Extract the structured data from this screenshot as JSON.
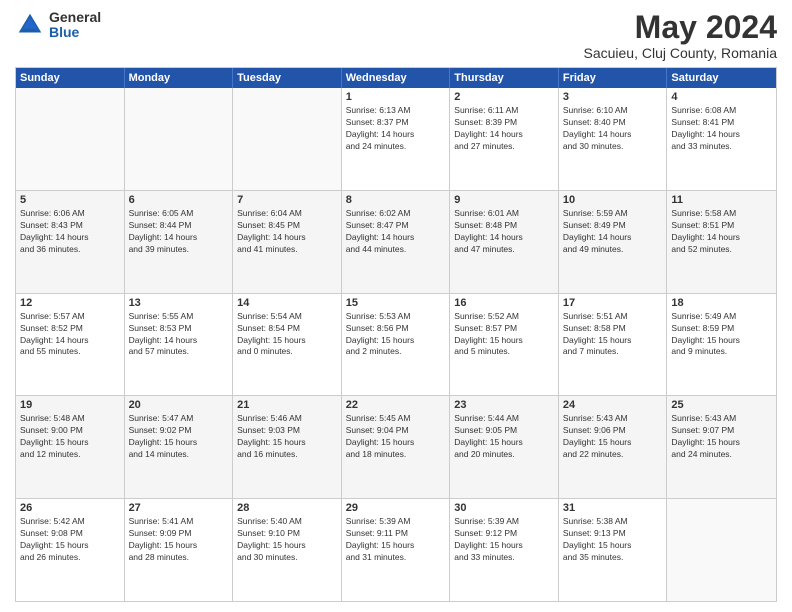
{
  "logo": {
    "general": "General",
    "blue": "Blue"
  },
  "title": "May 2024",
  "subtitle": "Sacuieu, Cluj County, Romania",
  "days": [
    "Sunday",
    "Monday",
    "Tuesday",
    "Wednesday",
    "Thursday",
    "Friday",
    "Saturday"
  ],
  "rows": [
    [
      {
        "num": "",
        "lines": []
      },
      {
        "num": "",
        "lines": []
      },
      {
        "num": "",
        "lines": []
      },
      {
        "num": "1",
        "lines": [
          "Sunrise: 6:13 AM",
          "Sunset: 8:37 PM",
          "Daylight: 14 hours",
          "and 24 minutes."
        ]
      },
      {
        "num": "2",
        "lines": [
          "Sunrise: 6:11 AM",
          "Sunset: 8:39 PM",
          "Daylight: 14 hours",
          "and 27 minutes."
        ]
      },
      {
        "num": "3",
        "lines": [
          "Sunrise: 6:10 AM",
          "Sunset: 8:40 PM",
          "Daylight: 14 hours",
          "and 30 minutes."
        ]
      },
      {
        "num": "4",
        "lines": [
          "Sunrise: 6:08 AM",
          "Sunset: 8:41 PM",
          "Daylight: 14 hours",
          "and 33 minutes."
        ]
      }
    ],
    [
      {
        "num": "5",
        "lines": [
          "Sunrise: 6:06 AM",
          "Sunset: 8:43 PM",
          "Daylight: 14 hours",
          "and 36 minutes."
        ]
      },
      {
        "num": "6",
        "lines": [
          "Sunrise: 6:05 AM",
          "Sunset: 8:44 PM",
          "Daylight: 14 hours",
          "and 39 minutes."
        ]
      },
      {
        "num": "7",
        "lines": [
          "Sunrise: 6:04 AM",
          "Sunset: 8:45 PM",
          "Daylight: 14 hours",
          "and 41 minutes."
        ]
      },
      {
        "num": "8",
        "lines": [
          "Sunrise: 6:02 AM",
          "Sunset: 8:47 PM",
          "Daylight: 14 hours",
          "and 44 minutes."
        ]
      },
      {
        "num": "9",
        "lines": [
          "Sunrise: 6:01 AM",
          "Sunset: 8:48 PM",
          "Daylight: 14 hours",
          "and 47 minutes."
        ]
      },
      {
        "num": "10",
        "lines": [
          "Sunrise: 5:59 AM",
          "Sunset: 8:49 PM",
          "Daylight: 14 hours",
          "and 49 minutes."
        ]
      },
      {
        "num": "11",
        "lines": [
          "Sunrise: 5:58 AM",
          "Sunset: 8:51 PM",
          "Daylight: 14 hours",
          "and 52 minutes."
        ]
      }
    ],
    [
      {
        "num": "12",
        "lines": [
          "Sunrise: 5:57 AM",
          "Sunset: 8:52 PM",
          "Daylight: 14 hours",
          "and 55 minutes."
        ]
      },
      {
        "num": "13",
        "lines": [
          "Sunrise: 5:55 AM",
          "Sunset: 8:53 PM",
          "Daylight: 14 hours",
          "and 57 minutes."
        ]
      },
      {
        "num": "14",
        "lines": [
          "Sunrise: 5:54 AM",
          "Sunset: 8:54 PM",
          "Daylight: 15 hours",
          "and 0 minutes."
        ]
      },
      {
        "num": "15",
        "lines": [
          "Sunrise: 5:53 AM",
          "Sunset: 8:56 PM",
          "Daylight: 15 hours",
          "and 2 minutes."
        ]
      },
      {
        "num": "16",
        "lines": [
          "Sunrise: 5:52 AM",
          "Sunset: 8:57 PM",
          "Daylight: 15 hours",
          "and 5 minutes."
        ]
      },
      {
        "num": "17",
        "lines": [
          "Sunrise: 5:51 AM",
          "Sunset: 8:58 PM",
          "Daylight: 15 hours",
          "and 7 minutes."
        ]
      },
      {
        "num": "18",
        "lines": [
          "Sunrise: 5:49 AM",
          "Sunset: 8:59 PM",
          "Daylight: 15 hours",
          "and 9 minutes."
        ]
      }
    ],
    [
      {
        "num": "19",
        "lines": [
          "Sunrise: 5:48 AM",
          "Sunset: 9:00 PM",
          "Daylight: 15 hours",
          "and 12 minutes."
        ]
      },
      {
        "num": "20",
        "lines": [
          "Sunrise: 5:47 AM",
          "Sunset: 9:02 PM",
          "Daylight: 15 hours",
          "and 14 minutes."
        ]
      },
      {
        "num": "21",
        "lines": [
          "Sunrise: 5:46 AM",
          "Sunset: 9:03 PM",
          "Daylight: 15 hours",
          "and 16 minutes."
        ]
      },
      {
        "num": "22",
        "lines": [
          "Sunrise: 5:45 AM",
          "Sunset: 9:04 PM",
          "Daylight: 15 hours",
          "and 18 minutes."
        ]
      },
      {
        "num": "23",
        "lines": [
          "Sunrise: 5:44 AM",
          "Sunset: 9:05 PM",
          "Daylight: 15 hours",
          "and 20 minutes."
        ]
      },
      {
        "num": "24",
        "lines": [
          "Sunrise: 5:43 AM",
          "Sunset: 9:06 PM",
          "Daylight: 15 hours",
          "and 22 minutes."
        ]
      },
      {
        "num": "25",
        "lines": [
          "Sunrise: 5:43 AM",
          "Sunset: 9:07 PM",
          "Daylight: 15 hours",
          "and 24 minutes."
        ]
      }
    ],
    [
      {
        "num": "26",
        "lines": [
          "Sunrise: 5:42 AM",
          "Sunset: 9:08 PM",
          "Daylight: 15 hours",
          "and 26 minutes."
        ]
      },
      {
        "num": "27",
        "lines": [
          "Sunrise: 5:41 AM",
          "Sunset: 9:09 PM",
          "Daylight: 15 hours",
          "and 28 minutes."
        ]
      },
      {
        "num": "28",
        "lines": [
          "Sunrise: 5:40 AM",
          "Sunset: 9:10 PM",
          "Daylight: 15 hours",
          "and 30 minutes."
        ]
      },
      {
        "num": "29",
        "lines": [
          "Sunrise: 5:39 AM",
          "Sunset: 9:11 PM",
          "Daylight: 15 hours",
          "and 31 minutes."
        ]
      },
      {
        "num": "30",
        "lines": [
          "Sunrise: 5:39 AM",
          "Sunset: 9:12 PM",
          "Daylight: 15 hours",
          "and 33 minutes."
        ]
      },
      {
        "num": "31",
        "lines": [
          "Sunrise: 5:38 AM",
          "Sunset: 9:13 PM",
          "Daylight: 15 hours",
          "and 35 minutes."
        ]
      },
      {
        "num": "",
        "lines": []
      }
    ]
  ]
}
